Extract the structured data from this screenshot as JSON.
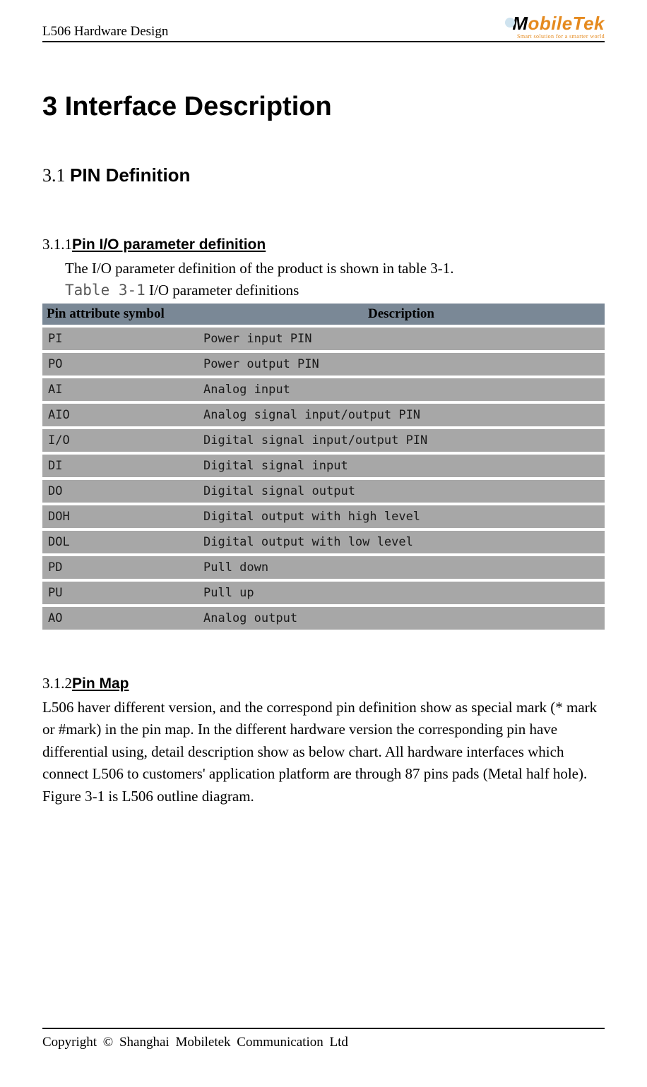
{
  "header": {
    "doc_title": "L506 Hardware Design",
    "logo_brand_m": "M",
    "logo_brand_obile": "obile",
    "logo_brand_tek": "Tek",
    "logo_slogan": "Smart solution for a smarter world"
  },
  "chapter": {
    "title": "3 Interface Description"
  },
  "section31": {
    "num": "3.1 ",
    "title": "PIN Definition"
  },
  "section311": {
    "num": "3.1.1 ",
    "title": "Pin I/O parameter definition",
    "intro": "The I/O parameter definition of the product is shown in table 3-1.",
    "caption_label": "Table 3-1",
    "caption_text": " I/O parameter definitions"
  },
  "table": {
    "headers": [
      "Pin attribute symbol",
      "Description"
    ],
    "rows": [
      {
        "sym": "PI",
        "desc": "Power input PIN"
      },
      {
        "sym": "PO",
        "desc": "Power output PIN"
      },
      {
        "sym": "AI",
        "desc": "Analog input"
      },
      {
        "sym": "AIO",
        "desc": "Analog signal input/output PIN"
      },
      {
        "sym": "I/O",
        "desc": "Digital signal input/output PIN"
      },
      {
        "sym": "DI",
        "desc": "Digital signal input"
      },
      {
        "sym": "DO",
        "desc": "Digital signal output"
      },
      {
        "sym": "DOH",
        "desc": "Digital output with high level"
      },
      {
        "sym": "DOL",
        "desc": "Digital output with low level"
      },
      {
        "sym": "PD",
        "desc": "Pull down"
      },
      {
        "sym": "PU",
        "desc": "Pull up"
      },
      {
        "sym": "AO",
        "desc": "Analog output"
      }
    ]
  },
  "section312": {
    "num": "3.1.2 ",
    "title": "Pin Map",
    "body": "L506 haver different version, and the correspond pin definition show as special mark (* mark or #mark) in the pin map. In the different hardware version the corresponding pin have differential using, detail description show as below chart. All hardware interfaces which connect L506 to customers' application platform are through 87 pins pads (Metal half hole). Figure 3-1 is L506 outline diagram."
  },
  "footer": {
    "text": "Copyright  ©  Shanghai  Mobiletek  Communication  Ltd"
  }
}
